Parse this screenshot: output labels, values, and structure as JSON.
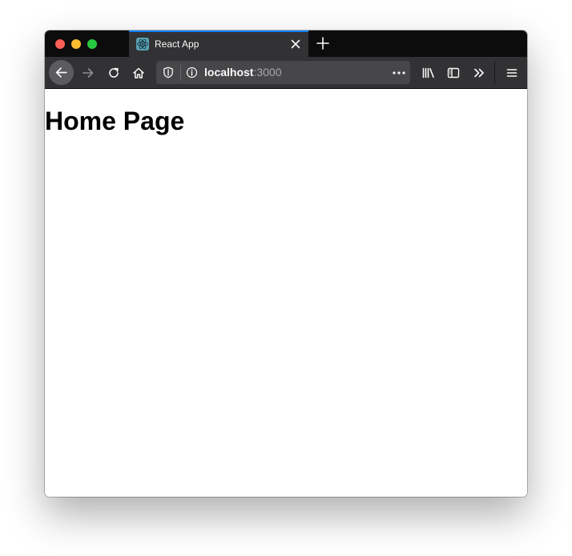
{
  "tab": {
    "title": "React App",
    "favicon": "react-atom-icon"
  },
  "navbar": {
    "url_host": "localhost",
    "url_port": ":3000"
  },
  "page": {
    "heading": "Home Page"
  },
  "colors": {
    "tab_accent": "#0a84ff",
    "toolbar_bg": "#323234",
    "tabstrip_bg": "#0c0c0d",
    "urlbar_bg": "#474749",
    "close_red": "#fe5f57",
    "minimize_yellow": "#febc2e",
    "zoom_green": "#28c840"
  }
}
